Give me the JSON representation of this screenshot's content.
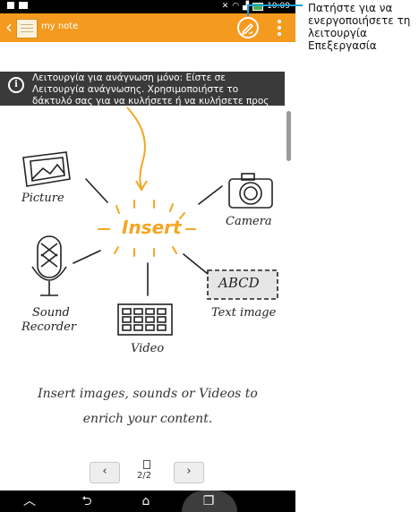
{
  "statusbar": {
    "time": "10:09",
    "icons": [
      "sim-card-icon",
      "image-notification-icon",
      "mute-icon",
      "wifi-icon",
      "signal-icon",
      "battery-icon"
    ]
  },
  "actionbar": {
    "title": "my note",
    "back_icon": "chevron-left-icon",
    "app_icon": "notebook-icon",
    "edit_icon": "pen-icon",
    "menu_icon": "vertical-dots-icon",
    "color": "#f49b1f"
  },
  "callout": {
    "text": "Πατήστε για να ενεργοποιήσετε τη λειτουργία Επεξεργασία",
    "line_color": "#1da1d8"
  },
  "info_banner": {
    "icon": "info-icon",
    "text": "Λειτουργία για ανάγνωση μόνο: Είστε σε Λειτουργία ανάγνωσης. Χρησιμοποιήστε το δάκτυλό σας για να κυλήσετε ή να κυλήσετε προς τα πάνω/κάτω στη"
  },
  "illustration": {
    "center_word": "Insert",
    "accent_color": "#f5a623",
    "items": {
      "picture": "Picture",
      "camera": "Camera",
      "sound_line1": "Sound",
      "sound_line2": "Recorder",
      "text_image": "Text image",
      "text_image_box": "ABCD",
      "video": "Video"
    },
    "tagline_line1": "Insert images, sounds or Videos to",
    "tagline_line2": "enrich your content."
  },
  "pager": {
    "prev": "‹",
    "next": "›",
    "page": "2/2"
  },
  "navbar": {
    "back": "⮌",
    "home": "⌂",
    "recents": "❐",
    "collapse": "︿"
  }
}
